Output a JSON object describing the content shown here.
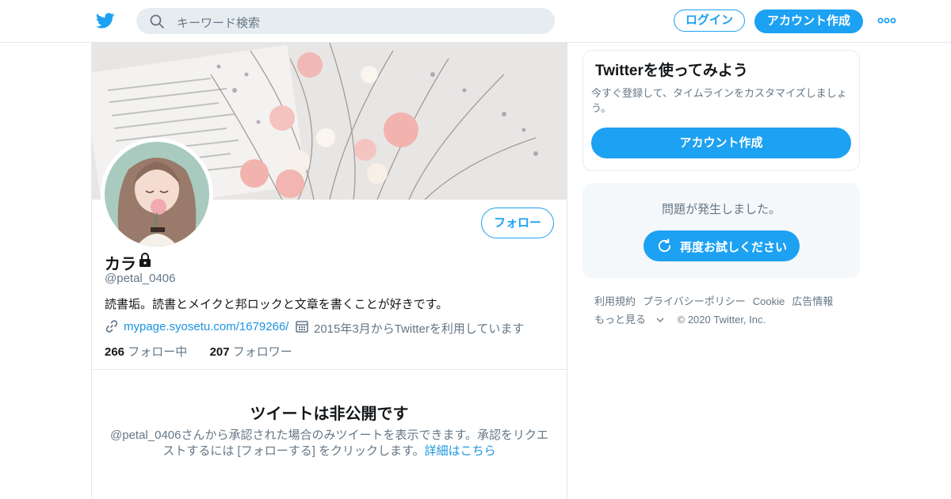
{
  "header": {
    "search_placeholder": "キーワード検索",
    "login_label": "ログイン",
    "signup_label": "アカウント作成"
  },
  "profile": {
    "name": "カラ",
    "handle": "@petal_0406",
    "bio": "読書垢。読書とメイクと邦ロックと文章を書くことが好きです。",
    "url": "mypage.syosetu.com/1679266/",
    "joined": "2015年3月からTwitterを利用しています",
    "following_count": "266",
    "following_label": "フォロー中",
    "followers_count": "207",
    "followers_label": "フォロワー",
    "follow_label": "フォロー",
    "protected_title": "ツイートは非公開です",
    "protected_body": "@petal_0406さんから承認された場合のみツイートを表示できます。承認をリクエストするには [フォローする] をクリックします。",
    "learn_more": "詳細はこちら"
  },
  "sidebar": {
    "card_title": "Twitterを使ってみよう",
    "card_text": "今すぐ登録して、タイムラインをカスタマイズしましょう。",
    "card_button": "アカウント作成",
    "error_text": "問題が発生しました。",
    "retry_label": "再度お試しください",
    "footer": {
      "terms": "利用規約",
      "privacy": "プライバシーポリシー",
      "cookie": "Cookie",
      "ads": "広告情報",
      "more": "もっと見る",
      "copyright": "© 2020 Twitter, Inc."
    }
  },
  "colors": {
    "accent": "#1da1f2",
    "link": "#1b95e0",
    "muted": "#657786"
  }
}
